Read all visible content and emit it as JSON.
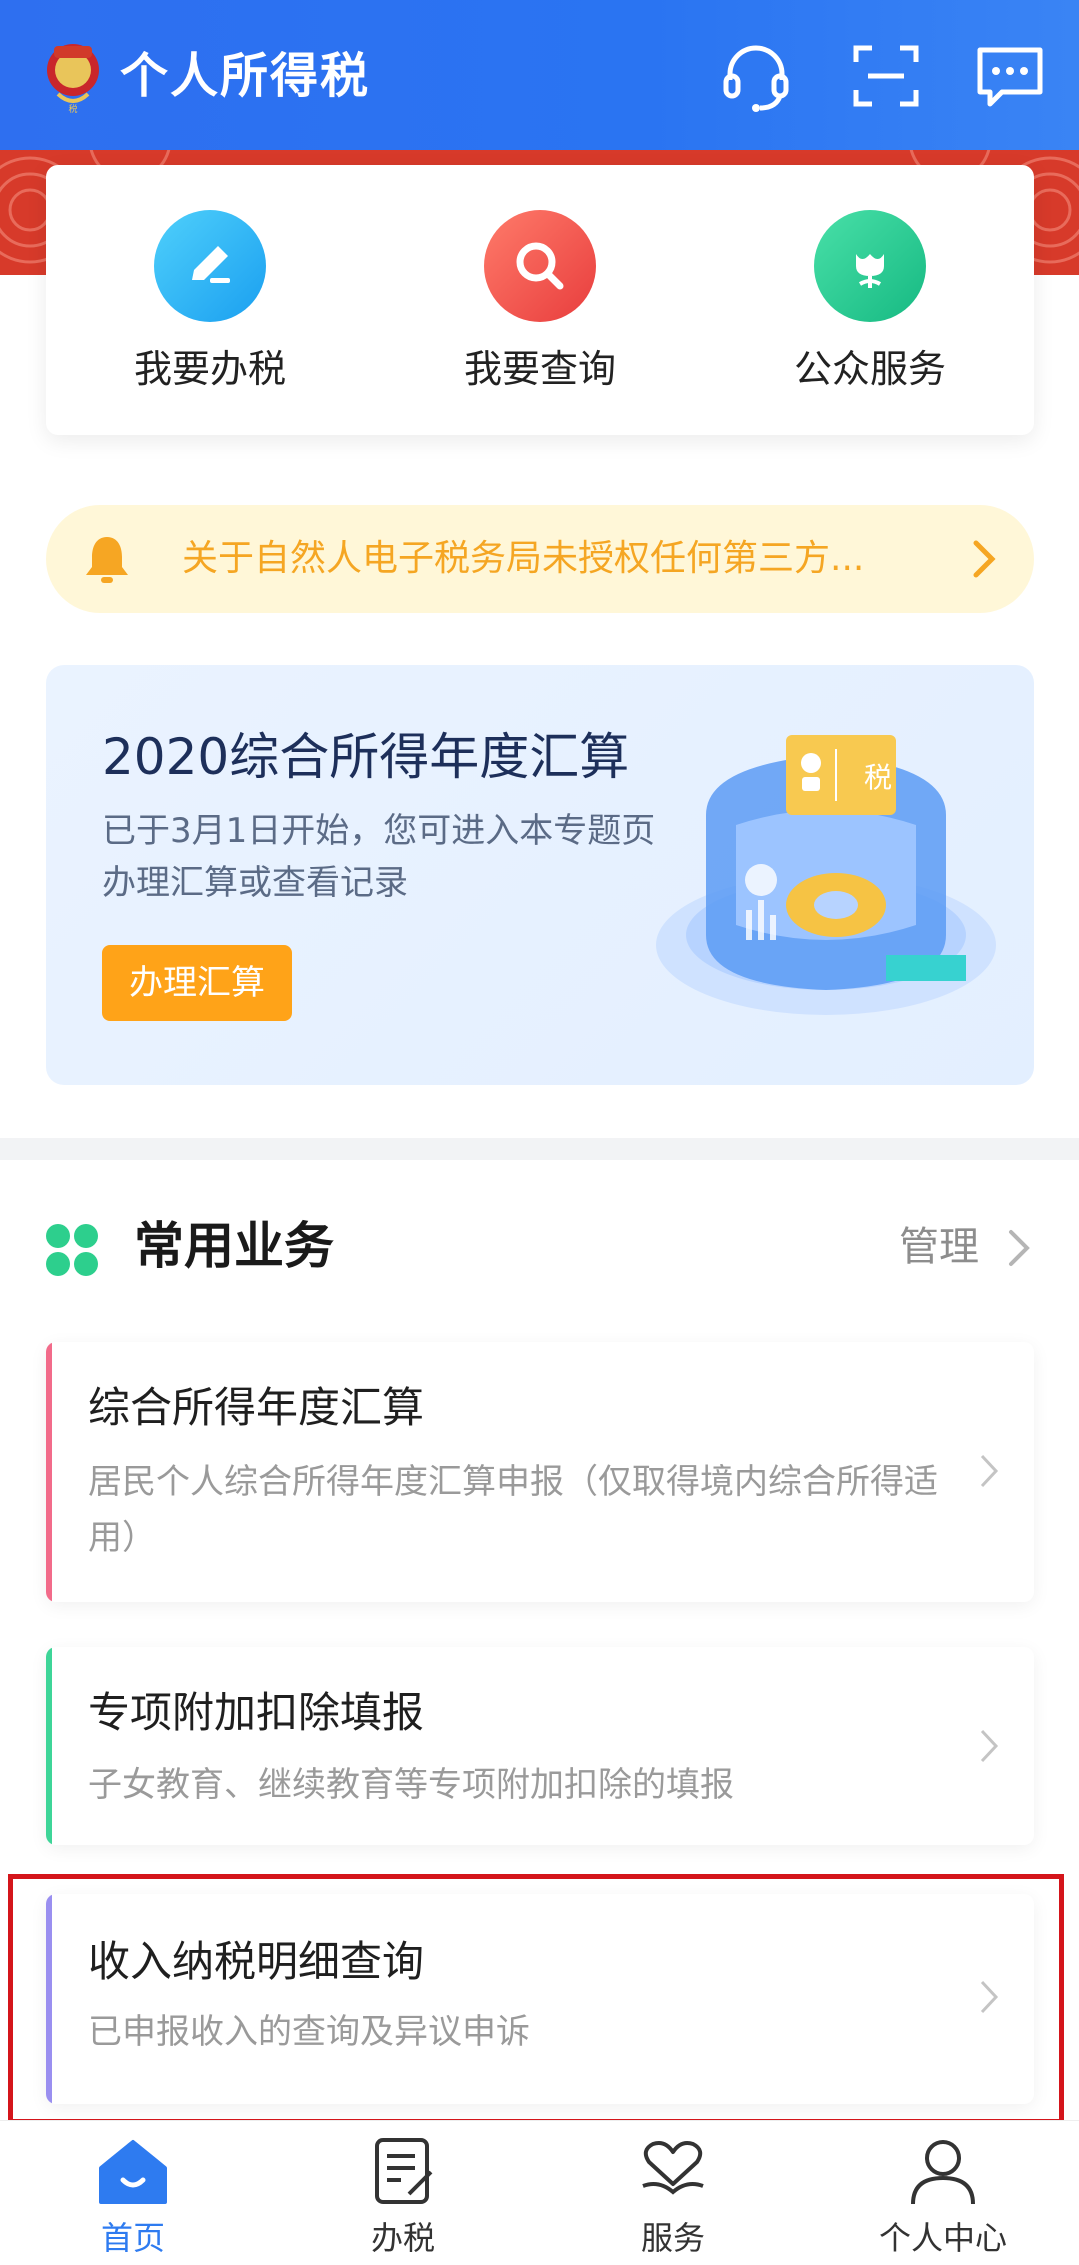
{
  "header": {
    "title": "个人所得税",
    "icons": [
      "headset-icon",
      "scan-icon",
      "message-icon"
    ]
  },
  "quick_actions": [
    {
      "label": "我要办税",
      "icon": "edit-icon",
      "color": "#2cb8f2"
    },
    {
      "label": "我要查询",
      "icon": "search-icon",
      "color": "#f4574a"
    },
    {
      "label": "公众服务",
      "icon": "flower-icon",
      "color": "#23c796"
    }
  ],
  "notice": {
    "text": "关于自然人电子税务局未授权任何第三方..."
  },
  "banner": {
    "title": "2020综合所得年度汇算",
    "desc": "已于3月1日开始，您可进入本专题页办理汇算或查看记录",
    "button": "办理汇算",
    "tag": "税"
  },
  "section": {
    "title": "常用业务",
    "manage": "管理"
  },
  "services": [
    {
      "title": "综合所得年度汇算",
      "desc": "居民个人综合所得年度汇算申报（仅取得境内综合所得适用）",
      "accent": "#f26b8a"
    },
    {
      "title": "专项附加扣除填报",
      "desc": "子女教育、继续教育等专项附加扣除的填报",
      "accent": "#3ed598"
    },
    {
      "title": "收入纳税明细查询",
      "desc": "已申报收入的查询及异议申诉",
      "accent": "#9a8ff0"
    }
  ],
  "nav": [
    {
      "label": "首页",
      "icon": "home-icon",
      "active": true
    },
    {
      "label": "办税",
      "icon": "form-icon",
      "active": false
    },
    {
      "label": "服务",
      "icon": "heart-hand-icon",
      "active": false
    },
    {
      "label": "个人中心",
      "icon": "person-icon",
      "active": false
    }
  ],
  "colors": {
    "primary": "#2e6ff0",
    "highlight_border": "#d4151b",
    "notice_text": "#f5a623",
    "button": "#ffa318"
  }
}
